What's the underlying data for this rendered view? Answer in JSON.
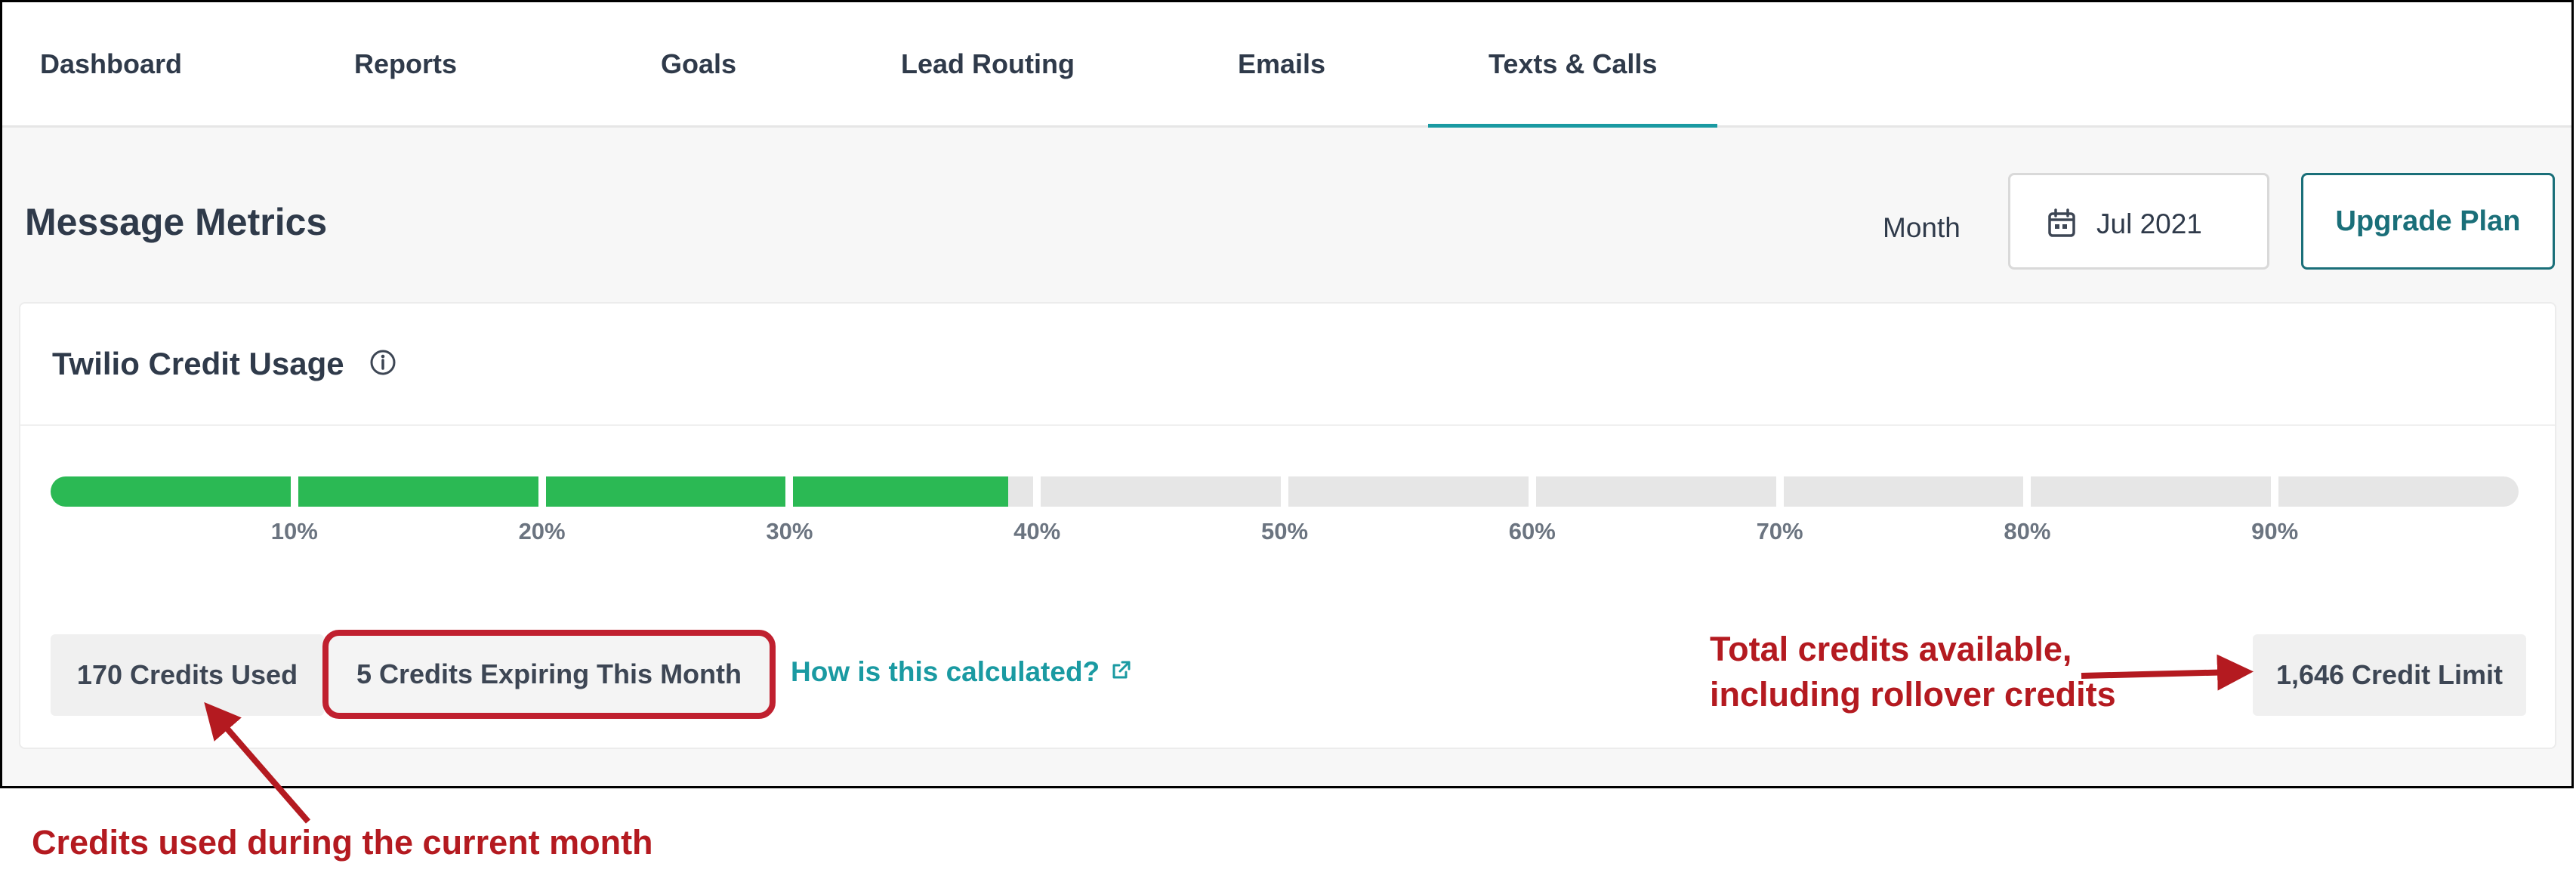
{
  "nav": {
    "tabs": [
      {
        "label": "Dashboard"
      },
      {
        "label": "Reports"
      },
      {
        "label": "Goals"
      },
      {
        "label": "Lead Routing"
      },
      {
        "label": "Emails"
      },
      {
        "label": "Texts & Calls",
        "active": true
      }
    ]
  },
  "header": {
    "title": "Message Metrics",
    "month_label": "Month",
    "month_value": "Jul 2021",
    "upgrade_label": "Upgrade Plan",
    "calendar_icon": "calendar-icon"
  },
  "card": {
    "title": "Twilio Credit Usage",
    "info_icon": "info-icon",
    "progress": {
      "used_fraction": 0.388,
      "ticks": [
        "10%",
        "20%",
        "30%",
        "40%",
        "50%",
        "60%",
        "70%",
        "80%",
        "90%"
      ],
      "fill_color": "#2bb954",
      "track_color": "#e6e6e6"
    },
    "used_label": "170 Credits Used",
    "expiring_label": "5 Credits Expiring This Month",
    "calc_link": "How is this calculated?",
    "external_icon": "external-link-icon",
    "limit_label": "1,646 Credit Limit"
  },
  "annotations": {
    "left": "Credits used during the current month",
    "right_line1": "Total credits available,",
    "right_line2": "including rollover credits",
    "color": "#b41a20"
  },
  "colors": {
    "accent": "#1a9aa2",
    "upgrade": "#1a6f79",
    "highlight_border": "#c0202f"
  }
}
